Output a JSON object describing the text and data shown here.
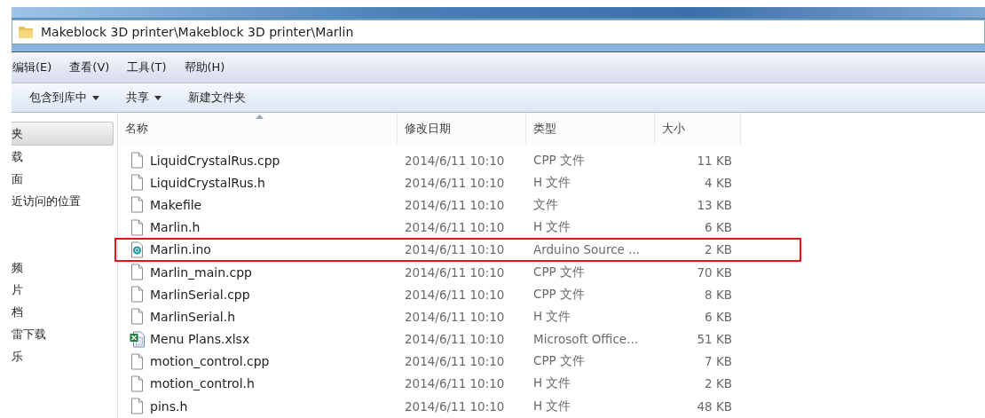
{
  "address_bar": {
    "path": "Makeblock 3D printer\\Makeblock 3D printer\\Marlin"
  },
  "menu_bar": [
    "编辑(E)",
    "查看(V)",
    "工具(T)",
    "帮助(H)"
  ],
  "toolbar": [
    {
      "label": "包含到库中",
      "dropdown": true
    },
    {
      "label": "共享",
      "dropdown": true
    },
    {
      "label": "新建文件夹",
      "dropdown": false
    }
  ],
  "sidebar": {
    "groups": [
      {
        "items": [
          {
            "label": "夹",
            "selected": true
          },
          {
            "label": "载",
            "selected": false
          },
          {
            "label": "面",
            "selected": false
          },
          {
            "label": "近访问的位置",
            "selected": false
          }
        ]
      },
      {
        "items": [
          {
            "label": "频",
            "selected": false
          },
          {
            "label": "片",
            "selected": false
          },
          {
            "label": "档",
            "selected": false
          },
          {
            "label": "雷下载",
            "selected": false
          },
          {
            "label": "乐",
            "selected": false
          }
        ]
      }
    ]
  },
  "table": {
    "columns": [
      "名称",
      "修改日期",
      "类型",
      "大小"
    ],
    "rows": [
      {
        "kind": "file",
        "name": "LiquidCrystalRus.cpp",
        "modified": "2014/6/11 10:10",
        "type": "CPP 文件",
        "size": "11 KB",
        "highlighted": false
      },
      {
        "kind": "file",
        "name": "LiquidCrystalRus.h",
        "modified": "2014/6/11 10:10",
        "type": "H 文件",
        "size": "4 KB",
        "highlighted": false
      },
      {
        "kind": "file",
        "name": "Makefile",
        "modified": "2014/6/11 10:10",
        "type": "文件",
        "size": "13 KB",
        "highlighted": false
      },
      {
        "kind": "file",
        "name": "Marlin.h",
        "modified": "2014/6/11 10:10",
        "type": "H 文件",
        "size": "6 KB",
        "highlighted": false
      },
      {
        "kind": "arduino",
        "name": "Marlin.ino",
        "modified": "2014/6/11 10:10",
        "type": "Arduino Source ...",
        "size": "2 KB",
        "highlighted": true
      },
      {
        "kind": "file",
        "name": "Marlin_main.cpp",
        "modified": "2014/6/11 10:10",
        "type": "CPP 文件",
        "size": "70 KB",
        "highlighted": false
      },
      {
        "kind": "file",
        "name": "MarlinSerial.cpp",
        "modified": "2014/6/11 10:10",
        "type": "CPP 文件",
        "size": "8 KB",
        "highlighted": false
      },
      {
        "kind": "file",
        "name": "MarlinSerial.h",
        "modified": "2014/6/11 10:10",
        "type": "H 文件",
        "size": "6 KB",
        "highlighted": false
      },
      {
        "kind": "excel",
        "name": "Menu Plans.xlsx",
        "modified": "2014/6/11 10:10",
        "type": "Microsoft Office...",
        "size": "51 KB",
        "highlighted": false
      },
      {
        "kind": "file",
        "name": "motion_control.cpp",
        "modified": "2014/6/11 10:10",
        "type": "CPP 文件",
        "size": "7 KB",
        "highlighted": false
      },
      {
        "kind": "file",
        "name": "motion_control.h",
        "modified": "2014/6/11 10:10",
        "type": "H 文件",
        "size": "2 KB",
        "highlighted": false
      },
      {
        "kind": "file",
        "name": "pins.h",
        "modified": "2014/6/11 10:10",
        "type": "H 文件",
        "size": "48 KB",
        "highlighted": false
      }
    ]
  }
}
